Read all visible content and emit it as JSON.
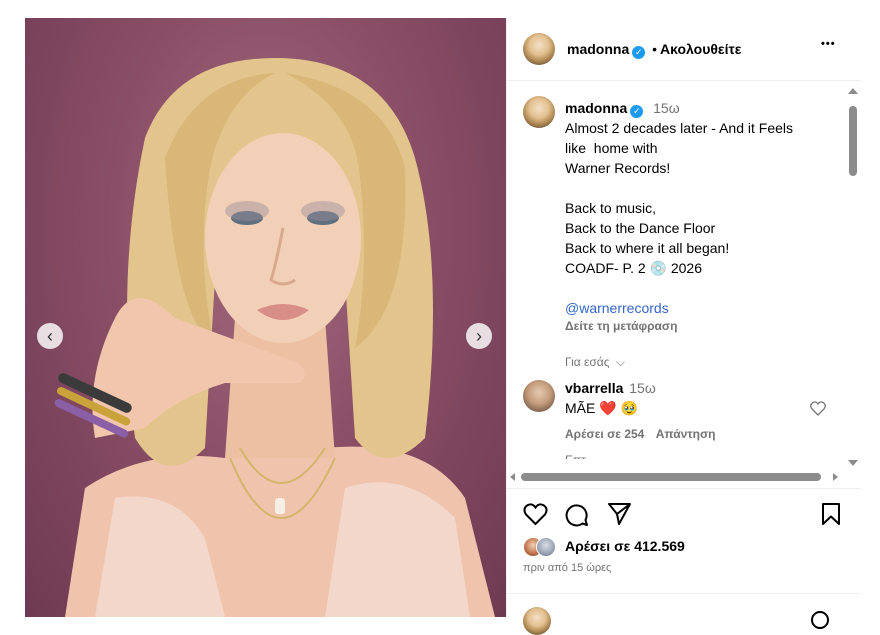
{
  "post": {
    "username": "madonna",
    "separator": "•",
    "follow_label": "Ακολουθείτε",
    "more_label": "•••"
  },
  "caption": {
    "username": "madonna",
    "time": "15ω",
    "lines": [
      "Almost 2 decades later - And it Feels",
      "like  home with",
      "Warner Records!",
      "",
      "Back to music,",
      "Back to the Dance Floor",
      "Back to where it all began!",
      "COADF- P. 2 💿 2026",
      ""
    ],
    "mention": "@warnerrecords",
    "translate": "Δείτε τη μετάφραση",
    "for_you": "Για εσάς",
    "for_you_chevron": "chevron-down-icon"
  },
  "comment": {
    "username": "vbarrella",
    "time": "15ω",
    "text": "MÃE ❤️ 🥹",
    "likes": "Αρέσει σε 254",
    "reply": "Απάντηση",
    "hidden_partial": "Επτ"
  },
  "footer": {
    "likes_text": "Αρέσει σε 412.569",
    "timestamp": "πριν από 15 ώρες"
  },
  "carousel": {
    "prev": "‹",
    "next": "›"
  },
  "colors": {
    "verified": "#1d9bf0",
    "link": "#3566c8",
    "muted": "#737373",
    "heart": "#e8336d"
  }
}
